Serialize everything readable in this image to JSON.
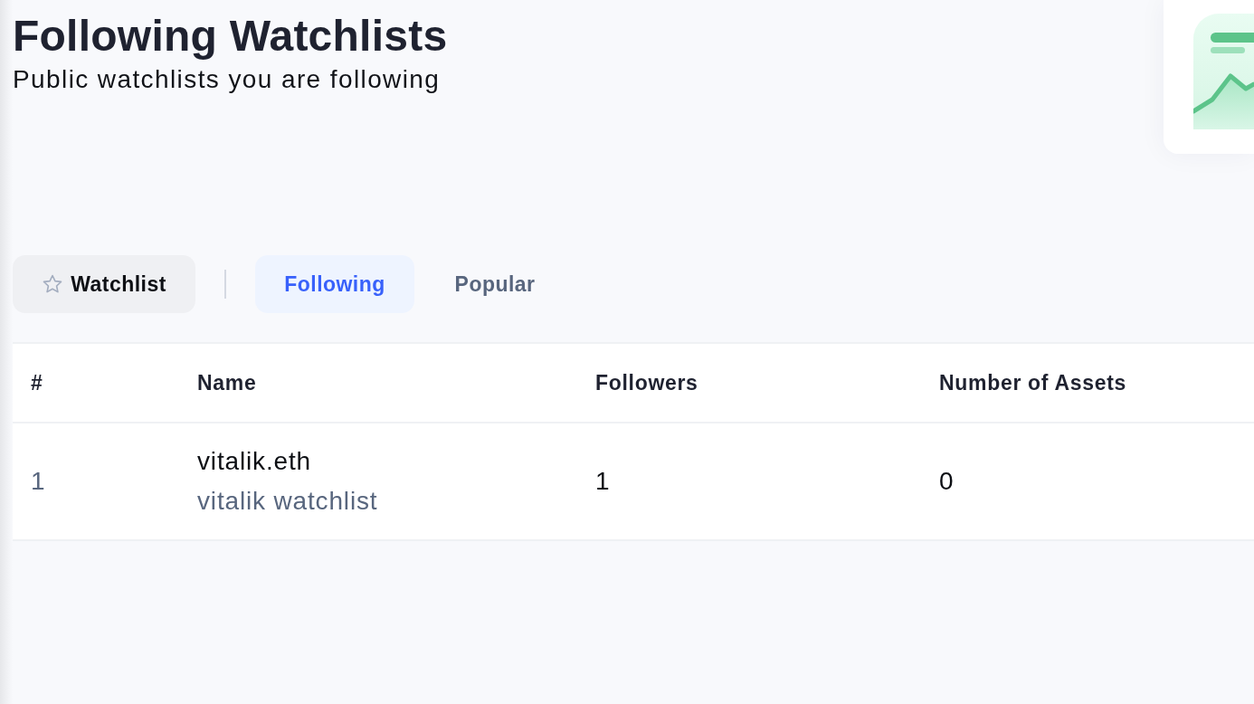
{
  "header": {
    "title": "Following Watchlists",
    "subtitle": "Public watchlists you are following"
  },
  "watchlist_button": {
    "label": "Watchlist"
  },
  "tabs": [
    {
      "label": "Following",
      "selected": true
    },
    {
      "label": "Popular",
      "selected": false
    }
  ],
  "table": {
    "columns": [
      "#",
      "Name",
      "Followers",
      "Number of Assets"
    ],
    "rows": [
      {
        "index": "1",
        "name": "vitalik.eth",
        "description": "vitalik watchlist",
        "followers": "1",
        "assets": "0"
      }
    ]
  }
}
